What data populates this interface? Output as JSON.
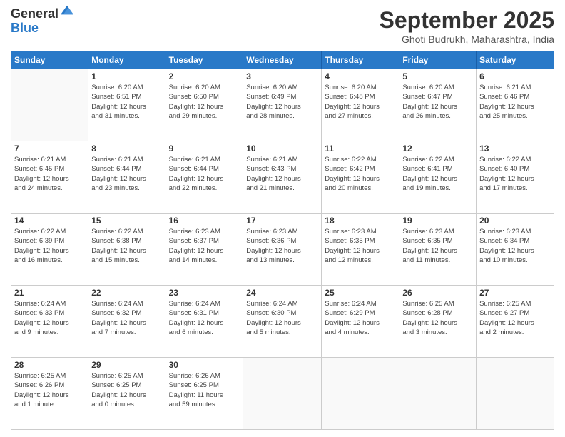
{
  "logo": {
    "general": "General",
    "blue": "Blue"
  },
  "header": {
    "month": "September 2025",
    "location": "Ghoti Budrukh, Maharashtra, India"
  },
  "weekdays": [
    "Sunday",
    "Monday",
    "Tuesday",
    "Wednesday",
    "Thursday",
    "Friday",
    "Saturday"
  ],
  "weeks": [
    [
      {
        "day": "",
        "info": ""
      },
      {
        "day": "1",
        "info": "Sunrise: 6:20 AM\nSunset: 6:51 PM\nDaylight: 12 hours\nand 31 minutes."
      },
      {
        "day": "2",
        "info": "Sunrise: 6:20 AM\nSunset: 6:50 PM\nDaylight: 12 hours\nand 29 minutes."
      },
      {
        "day": "3",
        "info": "Sunrise: 6:20 AM\nSunset: 6:49 PM\nDaylight: 12 hours\nand 28 minutes."
      },
      {
        "day": "4",
        "info": "Sunrise: 6:20 AM\nSunset: 6:48 PM\nDaylight: 12 hours\nand 27 minutes."
      },
      {
        "day": "5",
        "info": "Sunrise: 6:20 AM\nSunset: 6:47 PM\nDaylight: 12 hours\nand 26 minutes."
      },
      {
        "day": "6",
        "info": "Sunrise: 6:21 AM\nSunset: 6:46 PM\nDaylight: 12 hours\nand 25 minutes."
      }
    ],
    [
      {
        "day": "7",
        "info": "Sunrise: 6:21 AM\nSunset: 6:45 PM\nDaylight: 12 hours\nand 24 minutes."
      },
      {
        "day": "8",
        "info": "Sunrise: 6:21 AM\nSunset: 6:44 PM\nDaylight: 12 hours\nand 23 minutes."
      },
      {
        "day": "9",
        "info": "Sunrise: 6:21 AM\nSunset: 6:44 PM\nDaylight: 12 hours\nand 22 minutes."
      },
      {
        "day": "10",
        "info": "Sunrise: 6:21 AM\nSunset: 6:43 PM\nDaylight: 12 hours\nand 21 minutes."
      },
      {
        "day": "11",
        "info": "Sunrise: 6:22 AM\nSunset: 6:42 PM\nDaylight: 12 hours\nand 20 minutes."
      },
      {
        "day": "12",
        "info": "Sunrise: 6:22 AM\nSunset: 6:41 PM\nDaylight: 12 hours\nand 19 minutes."
      },
      {
        "day": "13",
        "info": "Sunrise: 6:22 AM\nSunset: 6:40 PM\nDaylight: 12 hours\nand 17 minutes."
      }
    ],
    [
      {
        "day": "14",
        "info": "Sunrise: 6:22 AM\nSunset: 6:39 PM\nDaylight: 12 hours\nand 16 minutes."
      },
      {
        "day": "15",
        "info": "Sunrise: 6:22 AM\nSunset: 6:38 PM\nDaylight: 12 hours\nand 15 minutes."
      },
      {
        "day": "16",
        "info": "Sunrise: 6:23 AM\nSunset: 6:37 PM\nDaylight: 12 hours\nand 14 minutes."
      },
      {
        "day": "17",
        "info": "Sunrise: 6:23 AM\nSunset: 6:36 PM\nDaylight: 12 hours\nand 13 minutes."
      },
      {
        "day": "18",
        "info": "Sunrise: 6:23 AM\nSunset: 6:35 PM\nDaylight: 12 hours\nand 12 minutes."
      },
      {
        "day": "19",
        "info": "Sunrise: 6:23 AM\nSunset: 6:35 PM\nDaylight: 12 hours\nand 11 minutes."
      },
      {
        "day": "20",
        "info": "Sunrise: 6:23 AM\nSunset: 6:34 PM\nDaylight: 12 hours\nand 10 minutes."
      }
    ],
    [
      {
        "day": "21",
        "info": "Sunrise: 6:24 AM\nSunset: 6:33 PM\nDaylight: 12 hours\nand 9 minutes."
      },
      {
        "day": "22",
        "info": "Sunrise: 6:24 AM\nSunset: 6:32 PM\nDaylight: 12 hours\nand 7 minutes."
      },
      {
        "day": "23",
        "info": "Sunrise: 6:24 AM\nSunset: 6:31 PM\nDaylight: 12 hours\nand 6 minutes."
      },
      {
        "day": "24",
        "info": "Sunrise: 6:24 AM\nSunset: 6:30 PM\nDaylight: 12 hours\nand 5 minutes."
      },
      {
        "day": "25",
        "info": "Sunrise: 6:24 AM\nSunset: 6:29 PM\nDaylight: 12 hours\nand 4 minutes."
      },
      {
        "day": "26",
        "info": "Sunrise: 6:25 AM\nSunset: 6:28 PM\nDaylight: 12 hours\nand 3 minutes."
      },
      {
        "day": "27",
        "info": "Sunrise: 6:25 AM\nSunset: 6:27 PM\nDaylight: 12 hours\nand 2 minutes."
      }
    ],
    [
      {
        "day": "28",
        "info": "Sunrise: 6:25 AM\nSunset: 6:26 PM\nDaylight: 12 hours\nand 1 minute."
      },
      {
        "day": "29",
        "info": "Sunrise: 6:25 AM\nSunset: 6:25 PM\nDaylight: 12 hours\nand 0 minutes."
      },
      {
        "day": "30",
        "info": "Sunrise: 6:26 AM\nSunset: 6:25 PM\nDaylight: 11 hours\nand 59 minutes."
      },
      {
        "day": "",
        "info": ""
      },
      {
        "day": "",
        "info": ""
      },
      {
        "day": "",
        "info": ""
      },
      {
        "day": "",
        "info": ""
      }
    ]
  ]
}
